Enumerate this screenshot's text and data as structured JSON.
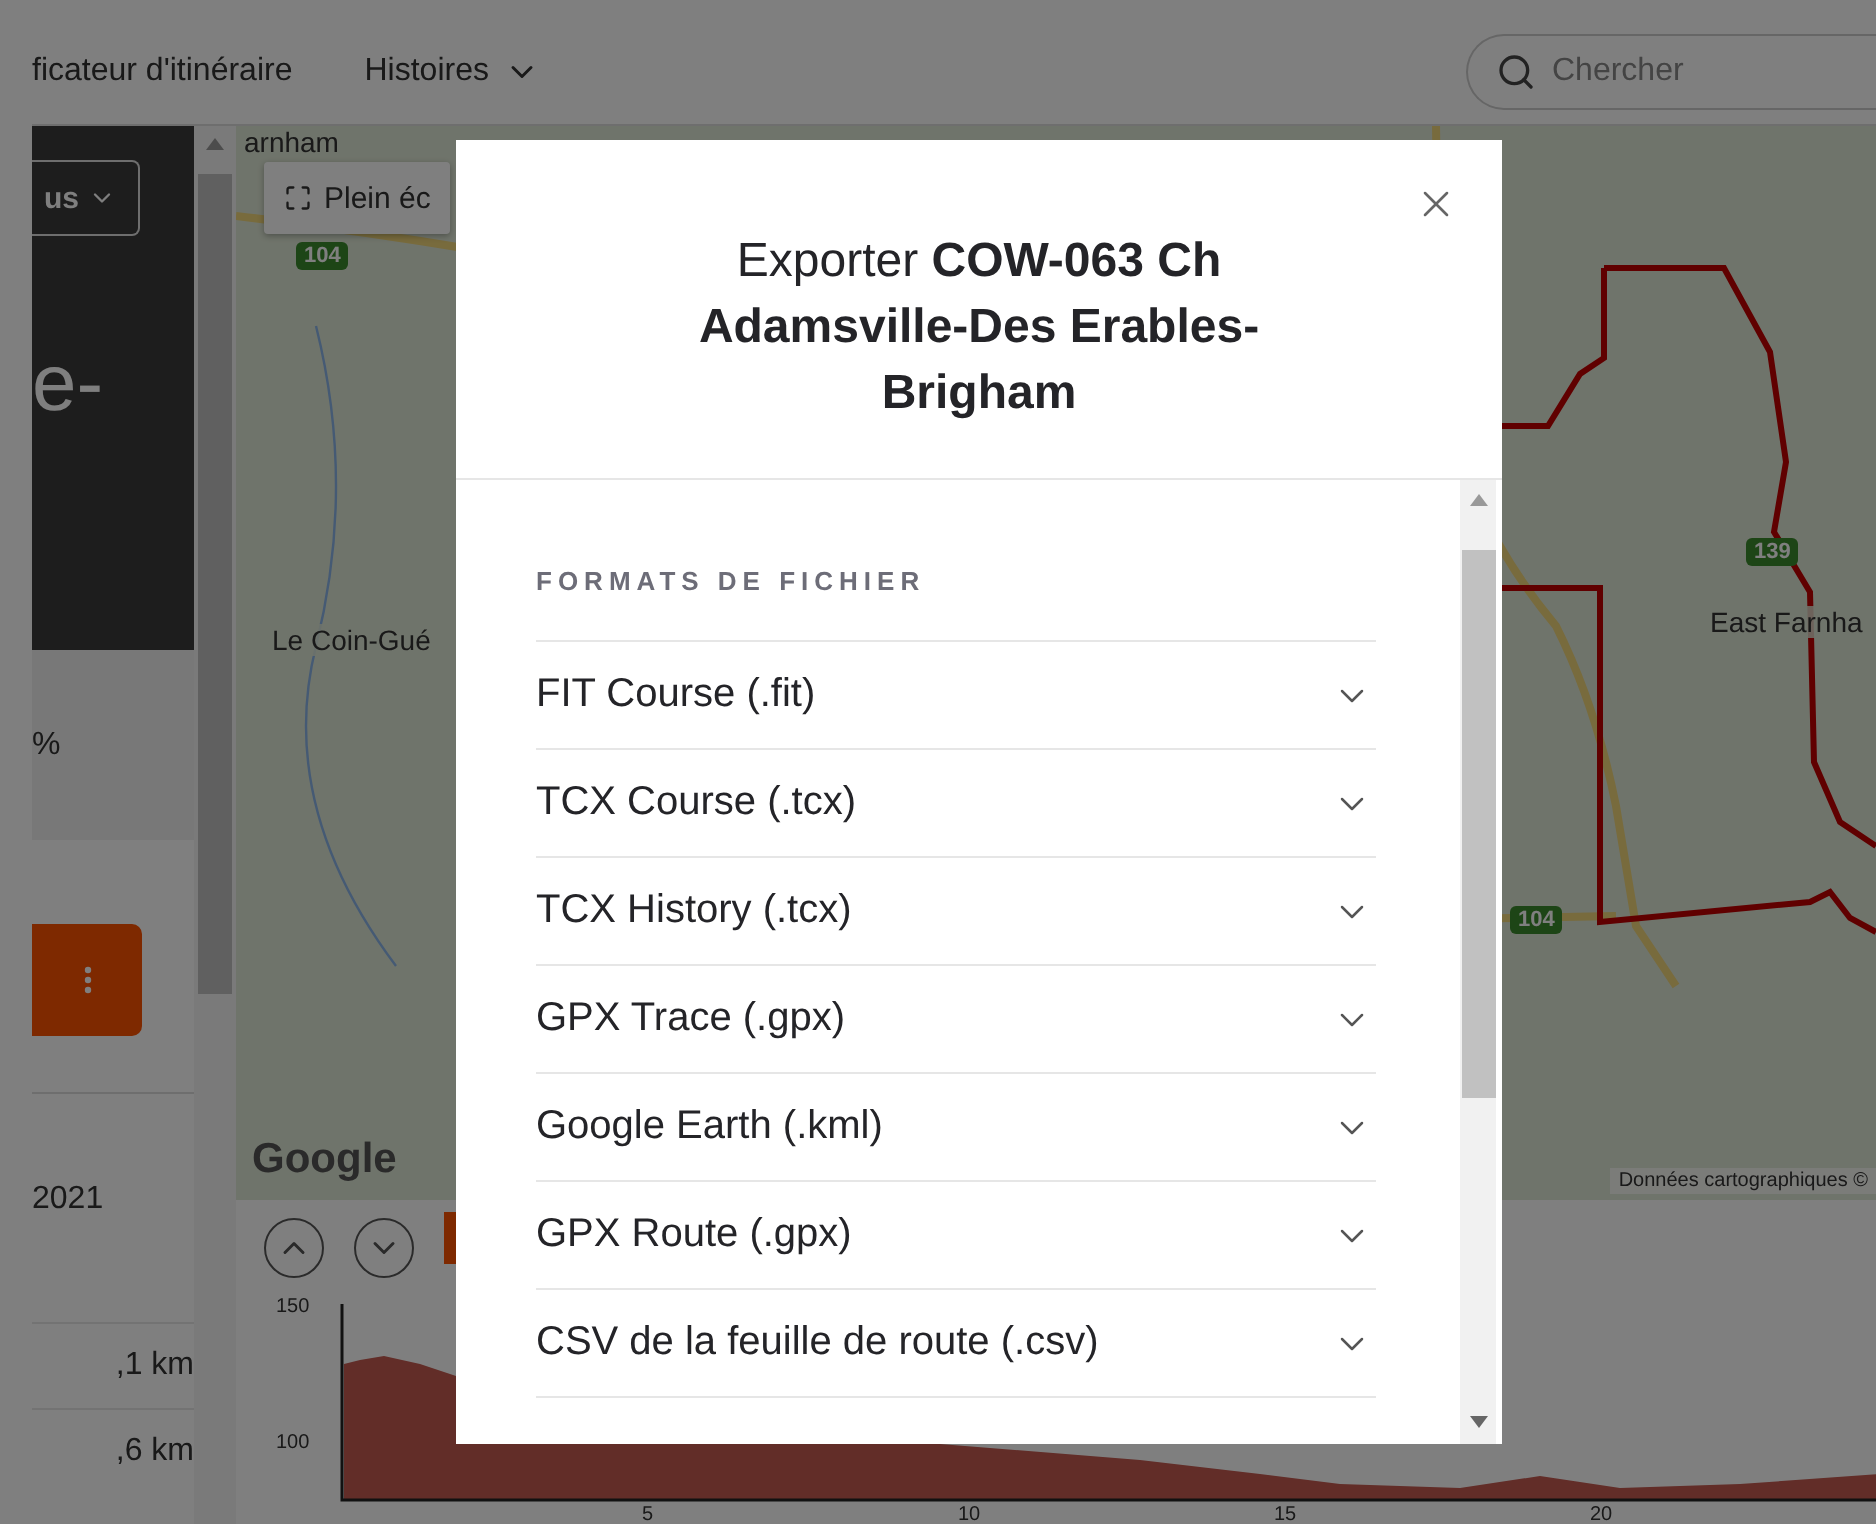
{
  "header": {
    "nav": [
      {
        "label": "ficateur d'itinéraire",
        "has_menu": false
      },
      {
        "label": "Histoires",
        "has_menu": true
      }
    ],
    "search": {
      "placeholder": "Chercher"
    }
  },
  "sidebar": {
    "filter_button": "us",
    "title": "e-",
    "percent": "%",
    "date": "2021",
    "distances": [
      ",1 km",
      ",6 km"
    ]
  },
  "map": {
    "fullscreen_button": "Plein éc",
    "place_labels": [
      "arnham",
      "Le Coin-Gué",
      "East Farnha"
    ],
    "road_shields": [
      "104",
      "139",
      "104"
    ],
    "logo": "Google",
    "attribution": "Données cartographiques ©"
  },
  "elevation": {
    "yticks": [
      "150",
      "100"
    ],
    "xticks": [
      "5",
      "10",
      "15",
      "20"
    ]
  },
  "dialog": {
    "title": "Exporter **COW-063 Ch Adamsville-Des Erables-Brigham**",
    "section_title": "FORMATS DE FICHIER",
    "formats": [
      {
        "label": "FIT Course (.fit)",
        "expanded": false
      },
      {
        "label": "TCX Course (.tcx)",
        "expanded": false
      },
      {
        "label": "TCX History (.tcx)",
        "expanded": false
      },
      {
        "label": "GPX Trace (.gpx)",
        "expanded": false
      },
      {
        "label": "Google Earth (.kml)",
        "expanded": false
      },
      {
        "label": "GPX Route (.gpx)",
        "expanded": false
      },
      {
        "label": "CSV de la feuille de route (.csv)",
        "expanded": false
      }
    ]
  }
}
